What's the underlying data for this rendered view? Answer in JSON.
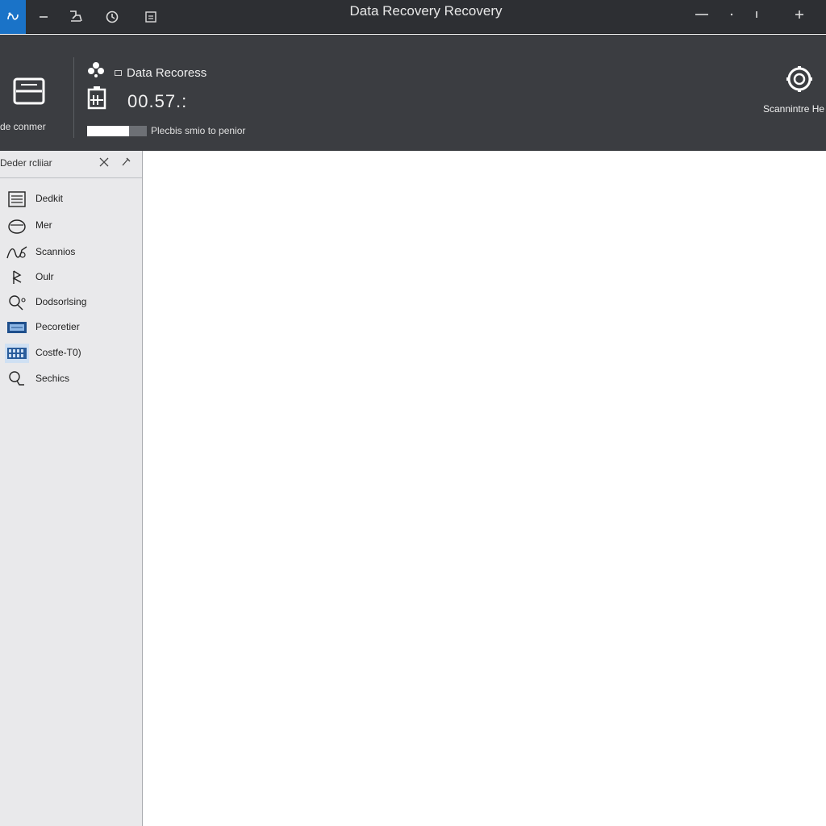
{
  "window": {
    "title": "Data Recovery Recovery"
  },
  "titlebar": {
    "icons": [
      "app-icon",
      "menu-icon",
      "tools-icon",
      "refresh-icon",
      "window-icon"
    ],
    "controls": [
      "minimize-icon",
      "dot-icon",
      "more-icon",
      "add-icon"
    ]
  },
  "header": {
    "device_label": "de conmer",
    "title": "Data Recoress",
    "value": "00.57.:",
    "progress": {
      "fraction": 0.7,
      "text": "Plecbis smio to penior"
    },
    "scan_label": "Scannintre He"
  },
  "sidebar": {
    "title": "Deder rcliiar",
    "items": [
      {
        "label": "Dedkit",
        "icon": "document-icon"
      },
      {
        "label": "Mer",
        "icon": "disk-icon"
      },
      {
        "label": "Scannios",
        "icon": "scan-wave-icon"
      },
      {
        "label": "Oulr",
        "icon": "output-icon"
      },
      {
        "label": "Dodsorlsing",
        "icon": "search-people-icon"
      },
      {
        "label": "Pecoretier",
        "icon": "panel-icon"
      },
      {
        "label": "Costfe-T0)",
        "icon": "grid-icon"
      },
      {
        "label": "Sechics",
        "icon": "magnifier-icon"
      }
    ]
  },
  "colors": {
    "titlebar": "#2d2f33",
    "ribbon": "#3b3d41",
    "accent": "#1a73c8",
    "sidebar": "#e9e9eb"
  }
}
